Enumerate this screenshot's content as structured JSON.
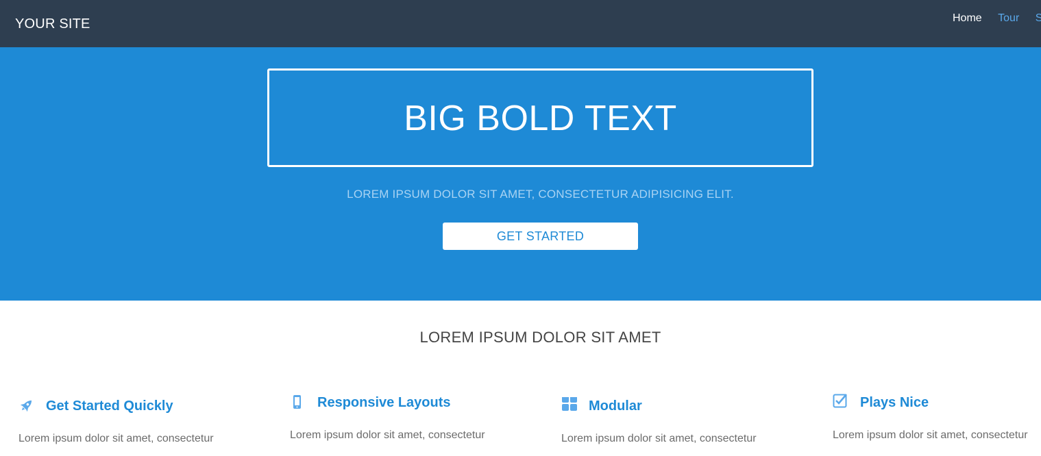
{
  "colors": {
    "nav_bg": "#2e3e50",
    "hero_bg": "#1e8ad6",
    "accent": "#1e8ad6",
    "icon_blue": "#5aa8ea",
    "nav_link": "#5aa8ea",
    "nav_active": "#ffffff"
  },
  "navbar": {
    "brand": "YOUR SITE",
    "links": [
      {
        "label": "Home",
        "active": true
      },
      {
        "label": "Tour",
        "active": false
      },
      {
        "label": "S",
        "active": false
      }
    ]
  },
  "hero": {
    "title": "BIG BOLD TEXT",
    "subtitle": "LOREM IPSUM DOLOR SIT AMET, CONSECTETUR ADIPISICING ELIT.",
    "cta_label": "GET STARTED"
  },
  "section": {
    "title": "LOREM IPSUM DOLOR SIT AMET"
  },
  "features": [
    {
      "icon": "rocket-icon",
      "title": "Get Started Quickly",
      "text": "Lorem ipsum dolor sit amet, consectetur"
    },
    {
      "icon": "mobile-icon",
      "title": "Responsive Layouts",
      "text": "Lorem ipsum dolor sit amet, consectetur"
    },
    {
      "icon": "grid-icon",
      "title": "Modular",
      "text": "Lorem ipsum dolor sit amet, consectetur"
    },
    {
      "icon": "checkbox-icon",
      "title": "Plays Nice",
      "text": "Lorem ipsum dolor sit amet, consectetur"
    }
  ]
}
